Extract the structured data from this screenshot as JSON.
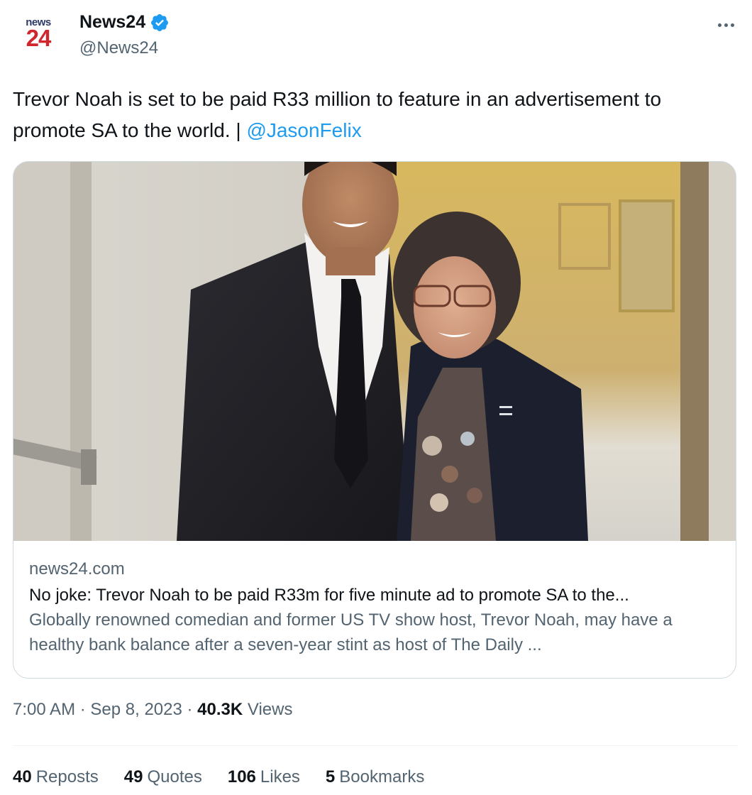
{
  "author": {
    "logo_top": "news",
    "logo_bottom": "24",
    "display_name": "News24",
    "handle": "@News24"
  },
  "tweet": {
    "text": "Trevor Noah is set to be paid R33 million to feature in an advertisement to promote SA to the world. | ",
    "mention": "@JasonFelix"
  },
  "card": {
    "domain": "news24.com",
    "title": "No joke: Trevor Noah to be paid R33m for five minute ad to promote SA to the...",
    "description": "Globally renowned comedian and former US TV show host, Trevor Noah, may have a healthy bank balance after a seven-year stint as host of The Daily ..."
  },
  "meta": {
    "time": "7:00 AM",
    "separator": " · ",
    "date": "Sep 8, 2023",
    "views_count": "40.3K",
    "views_label": " Views"
  },
  "stats": [
    {
      "count": "40",
      "label": "Reposts"
    },
    {
      "count": "49",
      "label": "Quotes"
    },
    {
      "count": "106",
      "label": "Likes"
    },
    {
      "count": "5",
      "label": "Bookmarks"
    }
  ],
  "colors": {
    "accent": "#1d9bf0",
    "secondary_text": "#536471",
    "primary_text": "#0f1419",
    "border": "#cfd9de",
    "logo_blue": "#2b3a67",
    "logo_red": "#d0262e"
  },
  "icons": {
    "verified": "verified-badge-icon",
    "more": "more-options-icon"
  }
}
